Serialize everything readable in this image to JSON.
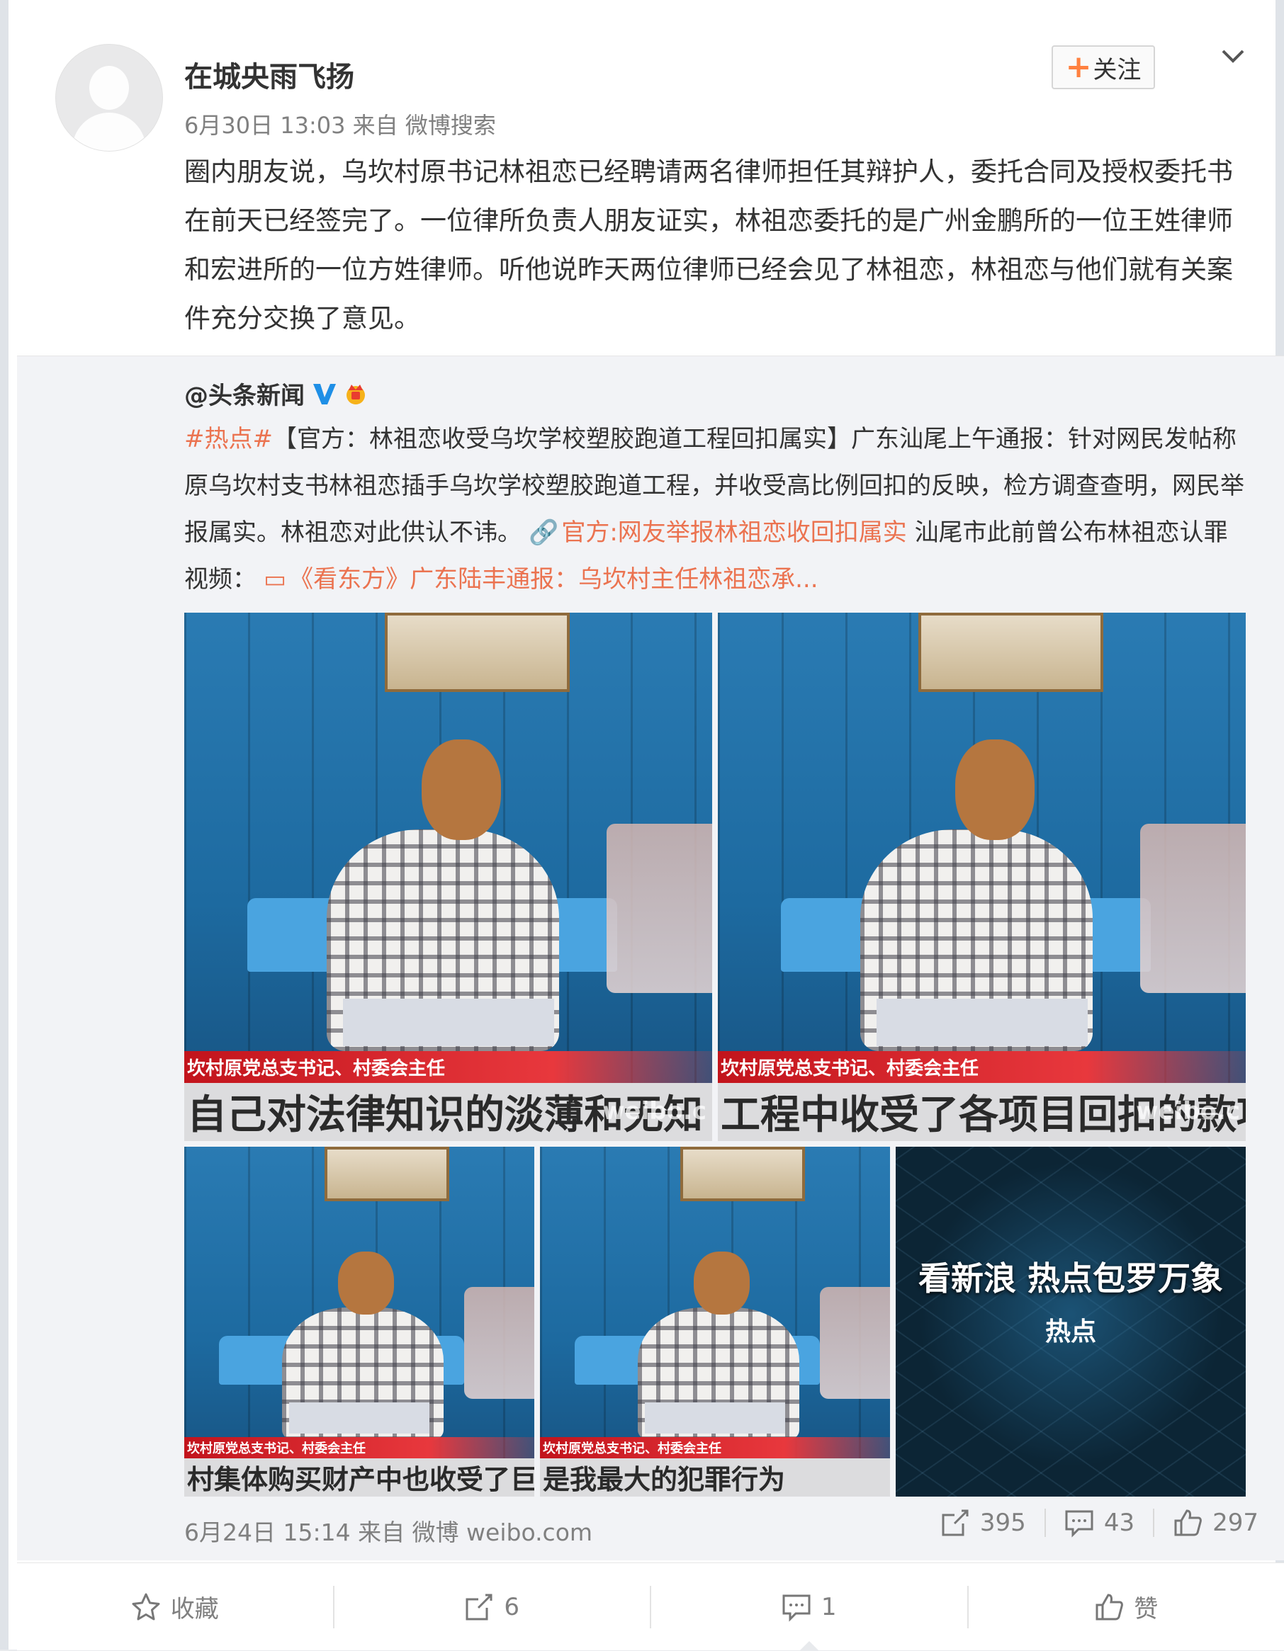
{
  "post": {
    "username": "在城央雨飞扬",
    "follow_label": "关注",
    "meta": "6月30日 13:03 来自 微博搜索",
    "text": "圈内朋友说，乌坎村原书记林祖恋已经聘请两名律师担任其辩护人，委托合同及授权委托书在前天已经签完了。一位律所负责人朋友证实，林祖恋委托的是广州金鹏所的一位王姓律师和宏进所的一位方姓律师。听他说昨天两位律师已经会见了林祖恋，林祖恋与他们就有关案件充分交换了意见。"
  },
  "repost": {
    "author": "@头条新闻",
    "hashtag": "#热点#",
    "text1": "【官方：林祖恋收受乌坎学校塑胶跑道工程回扣属实】广东汕尾上午通报：针对网民发帖称原乌坎村支书林祖恋插手乌坎学校塑胶跑道工程，并收受高比例回扣的反映，检方调查查明，网民举报属实。林祖恋对此供认不讳。",
    "link1": "官方:网友举报林祖恋收回扣属实",
    "text2": " 汕尾市此前曾公布林祖恋认罪视频：",
    "link2": "《看东方》广东陆丰通报：乌坎村主任林祖恋承...",
    "images": [
      {
        "caption": "坎村原党总支书记、村委会主任",
        "subtitle": "自己对法律知识的淡薄和无知",
        "watermark": "weibo.c"
      },
      {
        "caption": "坎村原党总支书记、村委会主任",
        "subtitle": "工程中收受了各项目回扣的款项",
        "watermark": "weibo.c"
      },
      {
        "caption": "坎村原党总支书记、村委会主任",
        "subtitle": "村集体购买财产中也收受了巨大的回扣"
      },
      {
        "caption": "坎村原党总支书记、村委会主任",
        "subtitle": "是我最大的犯罪行为"
      },
      {
        "headline": "看新浪 热点包罗万象",
        "logo": "热点"
      }
    ],
    "meta": "6月24日 15:14 来自 微博 weibo.com",
    "reposts": "395",
    "comments": "43",
    "likes": "297"
  },
  "footer": {
    "favorite": "收藏",
    "repost": "6",
    "comment": "1",
    "like": "赞"
  },
  "colors": {
    "link": "#eb7350",
    "follow_plus": "#ff8140",
    "verified": "#1f8fe6"
  }
}
